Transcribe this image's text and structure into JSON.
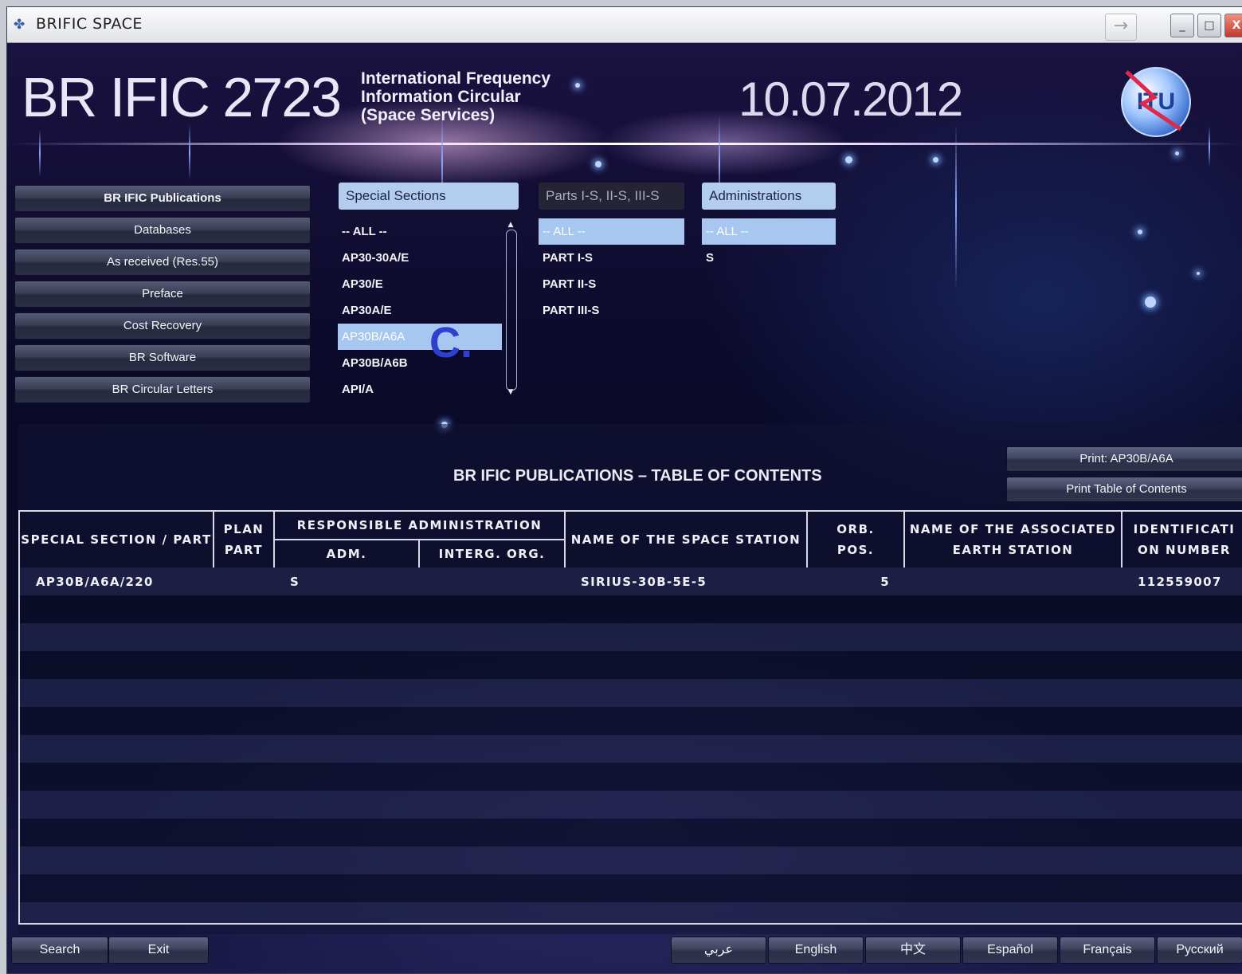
{
  "window": {
    "title": "BRIFIC SPACE",
    "controls": {
      "minimize": "_",
      "maximize": "□",
      "close": "X",
      "arrow": "→"
    }
  },
  "header": {
    "main_title": "BR IFIC 2723",
    "subtitle_line1": "International Frequency",
    "subtitle_line2": "Information Circular",
    "subtitle_line3": "(Space Services)",
    "date": "10.07.2012",
    "logo_text": "ITU"
  },
  "nav": {
    "items": [
      {
        "label": "BR IFIC Publications",
        "active": true
      },
      {
        "label": "Databases",
        "active": false
      },
      {
        "label": "As received (Res.55)",
        "active": false
      },
      {
        "label": "Preface",
        "active": false
      },
      {
        "label": "Cost Recovery",
        "active": false
      },
      {
        "label": "BR Software",
        "active": false
      },
      {
        "label": "BR Circular Letters",
        "active": false
      }
    ]
  },
  "special_sections": {
    "header": "Special Sections",
    "items": [
      "-- ALL --",
      "AP30-30A/E",
      "AP30/E",
      "AP30A/E",
      "AP30B/A6A",
      "AP30B/A6B",
      "API/A"
    ],
    "selected": "AP30B/A6A"
  },
  "parts": {
    "header": "Parts I-S, II-S, III-S",
    "items": [
      "-- ALL --",
      "PART I-S",
      "PART II-S",
      "PART III-S"
    ],
    "selected": "-- ALL --"
  },
  "administrations": {
    "header": "Administrations",
    "items": [
      "-- ALL --",
      "S"
    ],
    "selected": "-- ALL --"
  },
  "overlay_label": "C.",
  "toc": {
    "title": "BR IFIC PUBLICATIONS – TABLE OF CONTENTS",
    "print_selected": "Print: AP30B/A6A",
    "print_toc": "Print Table of Contents",
    "columns": {
      "special_section": "SPECIAL SECTION / PART",
      "plan_part_1": "PLAN",
      "plan_part_2": "PART",
      "responsible_admin": "RESPONSIBLE ADMINISTRATION",
      "adm": "ADM.",
      "interg_org": "INTERG. ORG.",
      "station_name": "NAME OF THE SPACE STATION",
      "orb_pos_1": "ORB.",
      "orb_pos_2": "POS.",
      "earth_station_1": "NAME OF THE ASSOCIATED",
      "earth_station_2": "EARTH STATION",
      "id_number_1": "IDENTIFICATI",
      "id_number_2": "ON NUMBER"
    },
    "rows": [
      {
        "section": "AP30B/A6A/220",
        "plan_part": "",
        "adm": "S",
        "interg_org": "",
        "station": "SIRIUS-30B-5E-5",
        "orb_pos": "5",
        "earth_station": "",
        "id": "112559007"
      }
    ]
  },
  "footer": {
    "search": "Search",
    "exit": "Exit",
    "languages": [
      "عربي",
      "English",
      "中文",
      "Español",
      "Français",
      "Русский"
    ]
  }
}
